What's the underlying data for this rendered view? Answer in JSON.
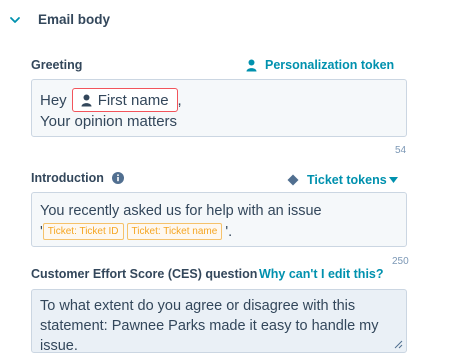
{
  "section": {
    "title": "Email body"
  },
  "greeting": {
    "label": "Greeting",
    "token_link": "Personalization token",
    "line1_prefix": "Hey",
    "token": "First name",
    "line1_suffix": ",",
    "line2": "Your opinion matters",
    "counter": "54"
  },
  "introduction": {
    "label": "Introduction",
    "token_link": "Ticket tokens",
    "line1": "You recently asked us for help with an issue",
    "open_quote": "'",
    "tokens": [
      "Ticket: Ticket ID",
      "Ticket: Ticket name"
    ],
    "close": "'.",
    "counter": "250"
  },
  "ces": {
    "label": "Customer Effort Score (CES) question",
    "help_link": "Why can't I edit this?",
    "text": "To what extent do you agree or disagree with this statement: Pawnee Parks made it easy to handle my issue."
  },
  "colors": {
    "link": "#0091ae",
    "text": "#33475b",
    "token_border": "#f2545b",
    "ticket_token": "#f5a623"
  },
  "icons": [
    "chevron-down-icon",
    "person-icon",
    "info-icon",
    "diamond-icon",
    "caret-down-icon",
    "resize-handle-icon"
  ]
}
